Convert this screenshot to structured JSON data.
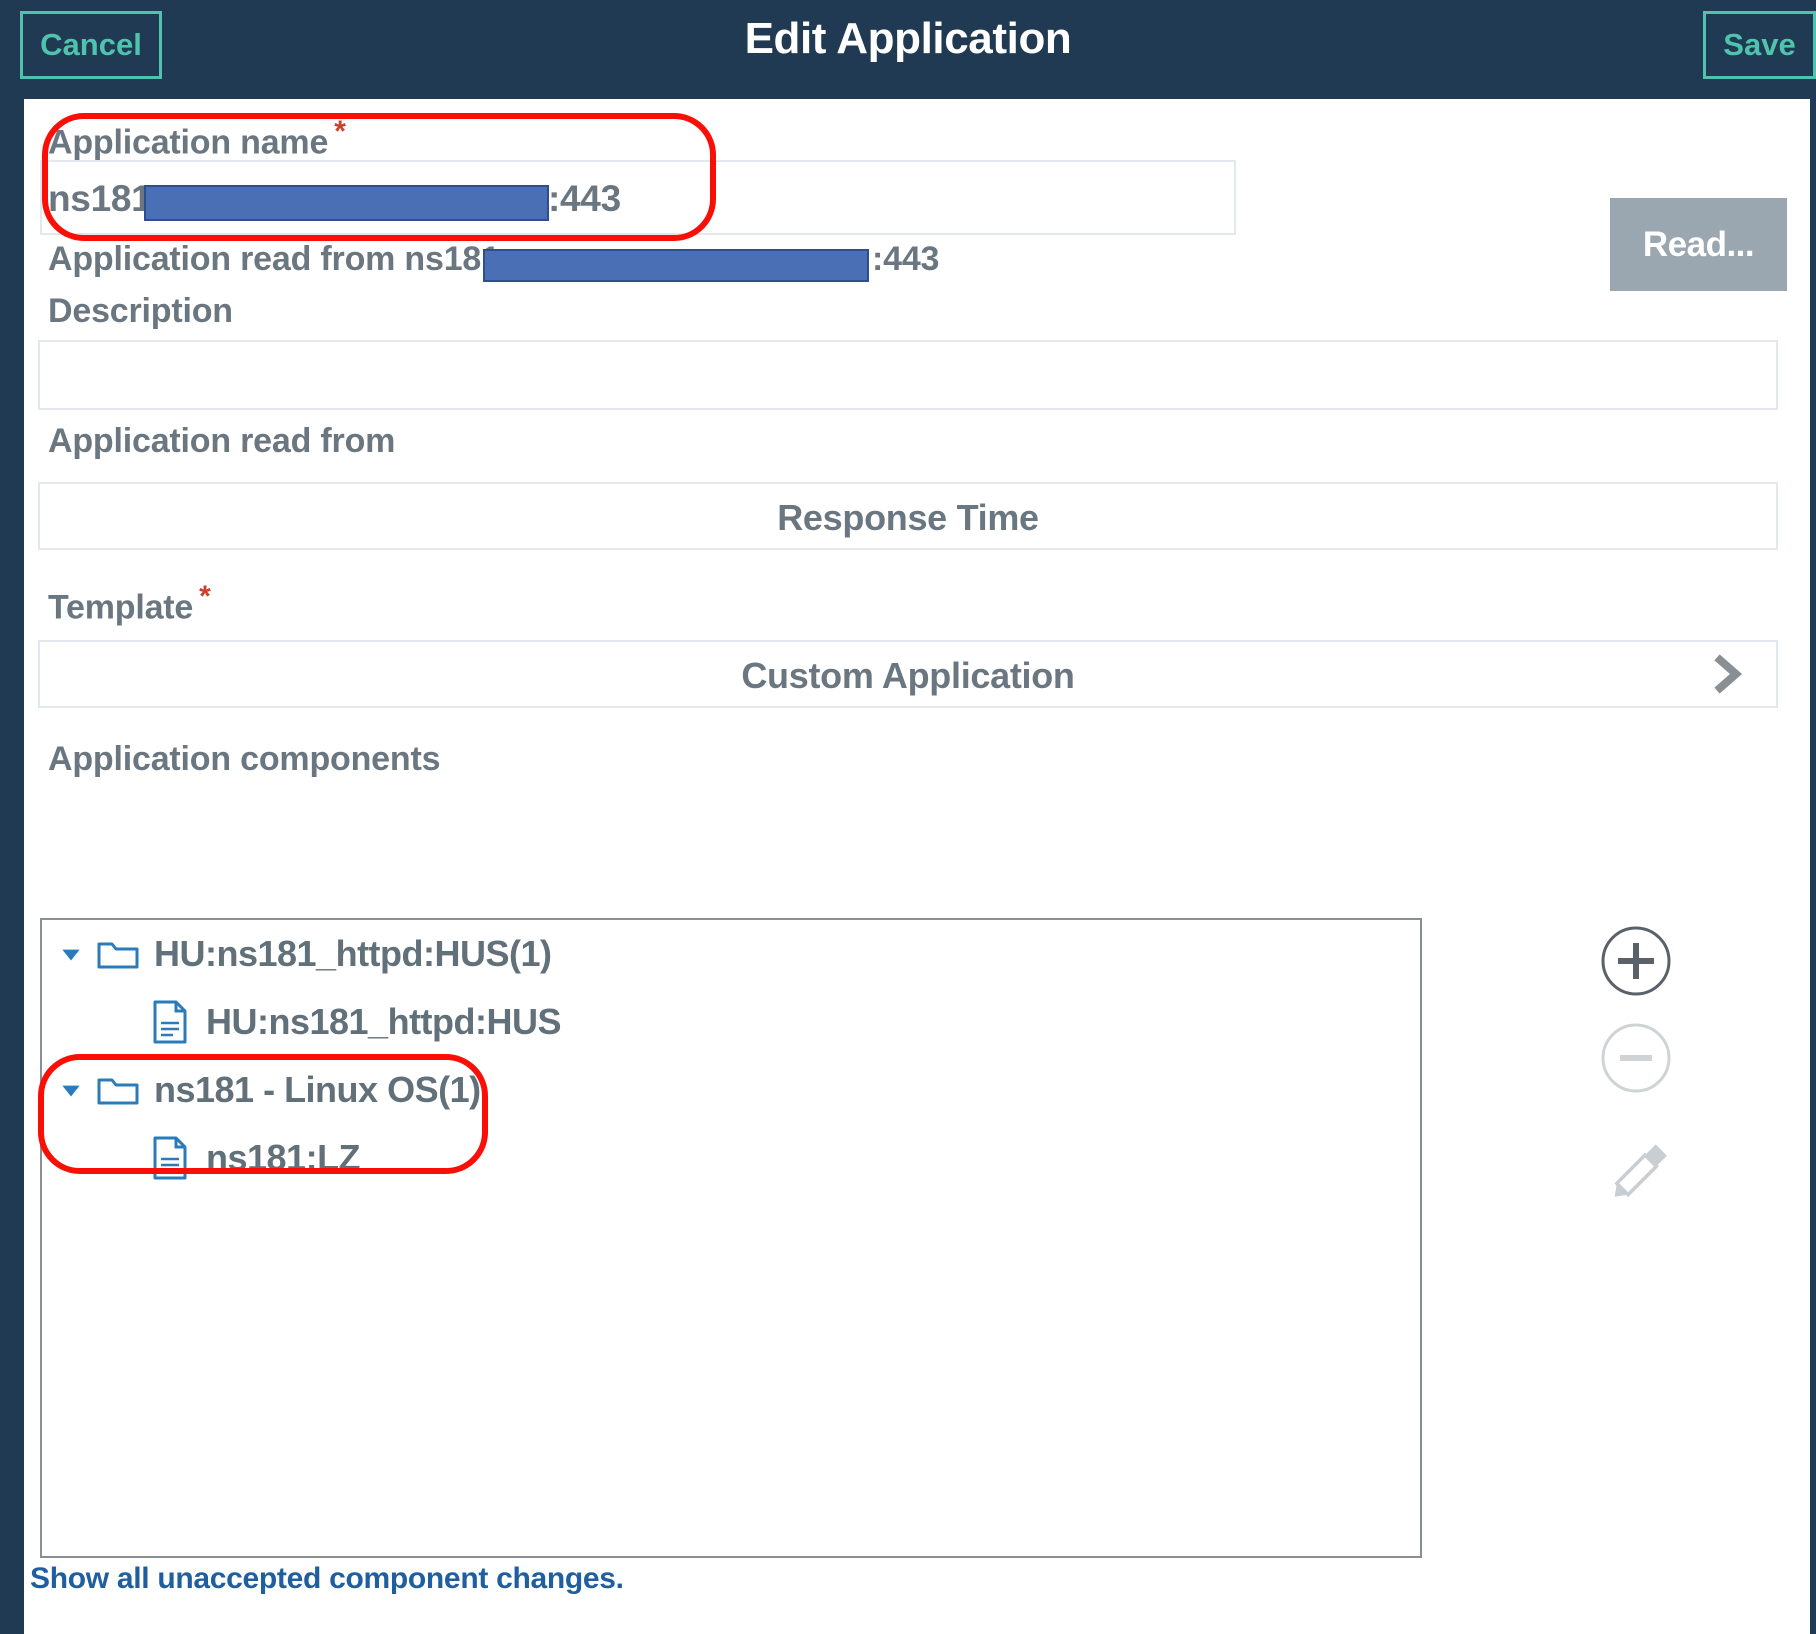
{
  "header": {
    "title": "Edit Application",
    "cancel_label": "Cancel",
    "save_label": "Save",
    "bar_color": "#1f3a52",
    "accent_color": "#4fc3ae"
  },
  "form": {
    "app_name": {
      "label": "Application name",
      "required_marker": "*",
      "value_prefix": "ns181.",
      "value_suffix": ":443",
      "redacted": true
    },
    "read_from_line": {
      "prefix": "Application read from ns181.s",
      "suffix": ":443",
      "redacted": true
    },
    "read_button_label": "Read...",
    "description": {
      "label": "Description",
      "value": "",
      "placeholder": ""
    },
    "application_read_from": {
      "label": "Application read from",
      "value": "Response Time"
    },
    "template": {
      "label": "Template",
      "required_marker": "*",
      "value": "Custom Application",
      "chevron_icon": "chevron-right-icon"
    }
  },
  "components": {
    "label": "Application components",
    "tree": [
      {
        "label": "HU:ns181_httpd:HUS(1)",
        "icon": "folder-icon",
        "twisty": "triangle-down-icon",
        "expanded": true,
        "children": [
          {
            "label": "HU:ns181_httpd:HUS",
            "icon": "document-icon"
          }
        ]
      },
      {
        "label": "ns181 - Linux OS(1)",
        "icon": "folder-icon",
        "twisty": "triangle-down-icon",
        "expanded": true,
        "children": [
          {
            "label": "ns181:LZ",
            "icon": "document-icon"
          }
        ]
      }
    ],
    "actions": [
      {
        "name": "add-component-button",
        "icon": "plus-circle-icon",
        "enabled": true
      },
      {
        "name": "remove-component-button",
        "icon": "minus-circle-icon",
        "enabled": false
      },
      {
        "name": "edit-component-button",
        "icon": "pencil-icon",
        "enabled": false
      }
    ]
  },
  "footer": {
    "link_label": "Show all unaccepted component changes.",
    "link_color": "#1f5fa0"
  },
  "annotations": {
    "color": "#fa0f06",
    "boxes": [
      {
        "name": "app-name-highlight",
        "target": "application-name-field"
      },
      {
        "name": "linux-os-highlight",
        "target": "tree-group-linux-os"
      }
    ]
  }
}
